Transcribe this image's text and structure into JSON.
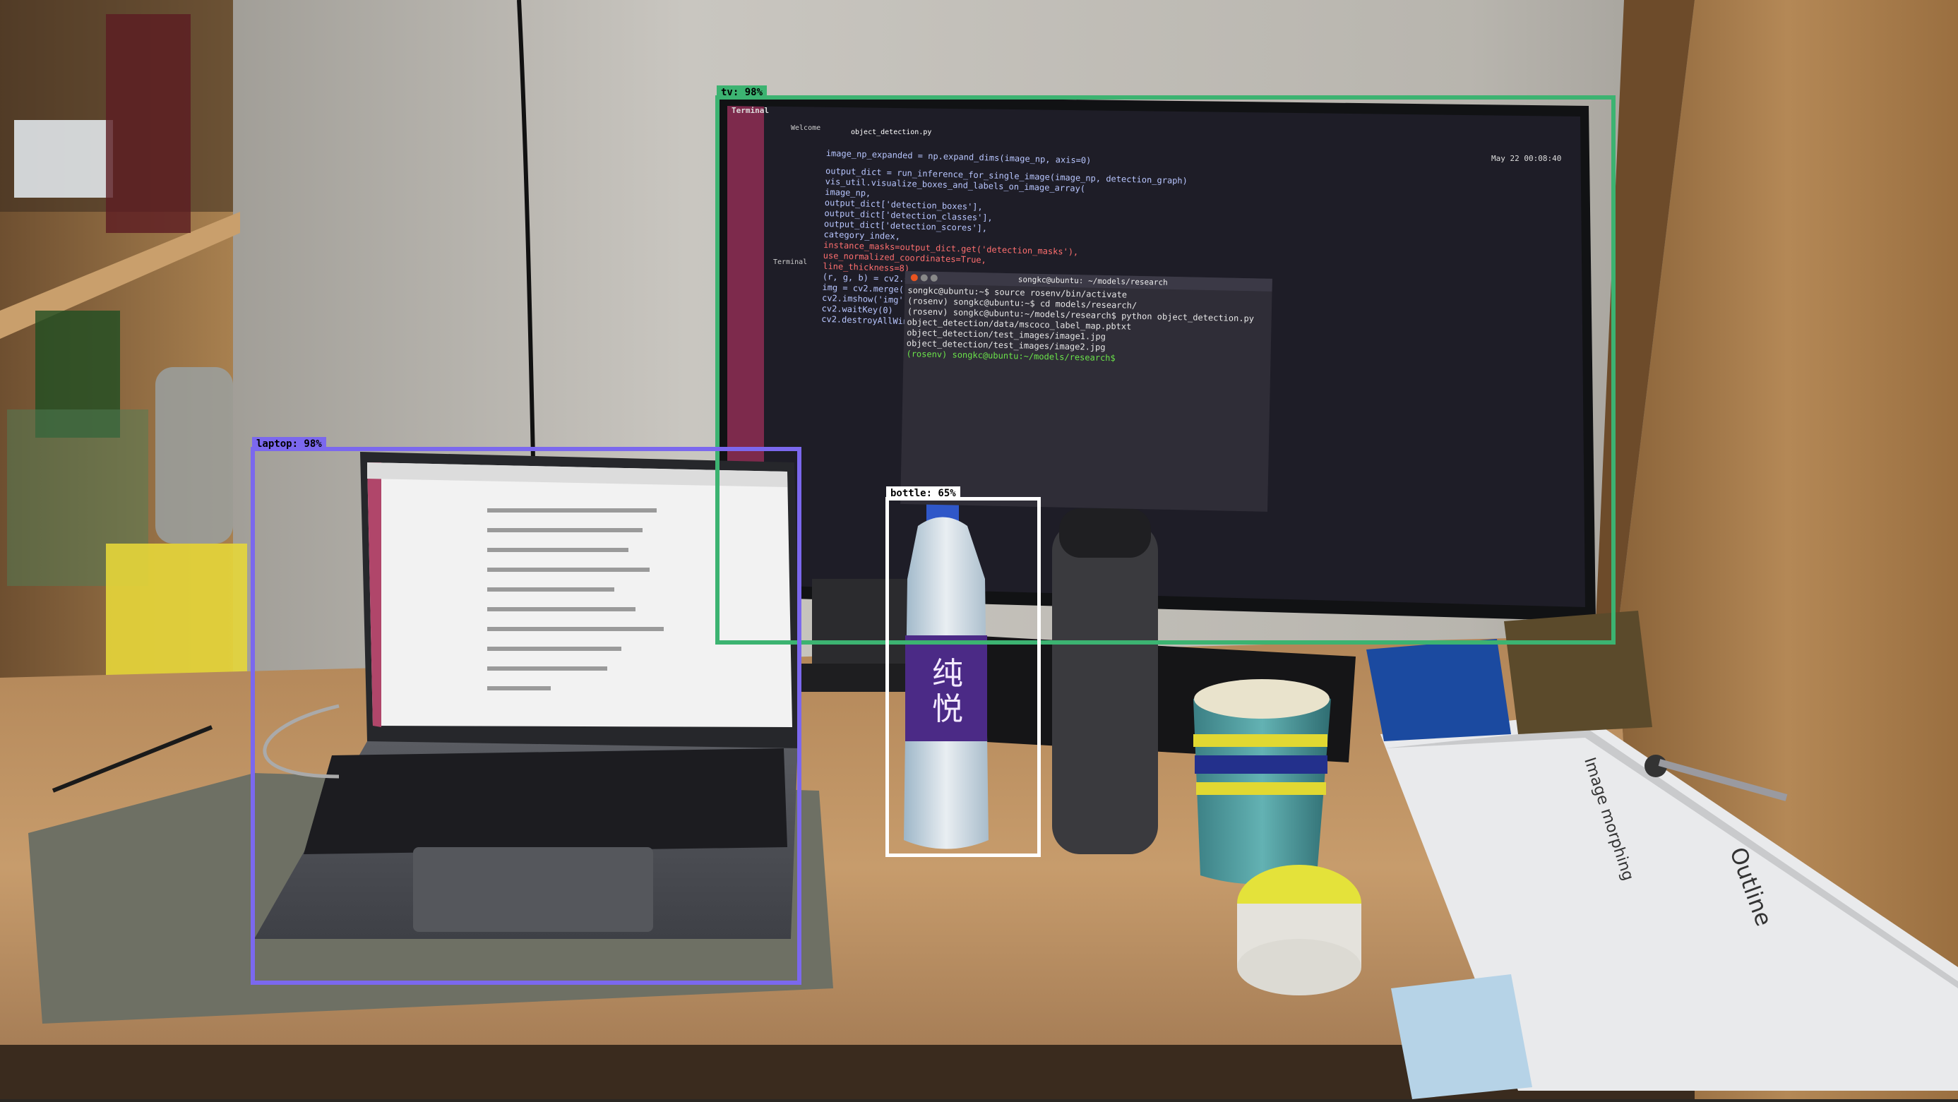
{
  "detections": [
    {
      "label": "tv",
      "score": "98%",
      "text": "tv: 98%",
      "color": "#3cb371"
    },
    {
      "label": "laptop",
      "score": "98%",
      "text": "laptop: 98%",
      "color": "#7b68ee"
    },
    {
      "label": "bottle",
      "score": "65%",
      "text": "bottle: 65%",
      "color": "#ffffff"
    }
  ],
  "monitor": {
    "app_title": "Terminal",
    "tab_welcome": "Welcome",
    "tab_file": "object_detection.py",
    "clock": "May 22 00:08:40",
    "panel_title": "Terminal",
    "code_lines": [
      "image_np_expanded = np.expand_dims(image_np, axis=0)",
      "output_dict = run_inference_for_single_image(image_np, detection_graph)",
      "vis_util.visualize_boxes_and_labels_on_image_array(",
      "    image_np,",
      "    output_dict['detection_boxes'],",
      "    output_dict['detection_classes'],",
      "    output_dict['detection_scores'],",
      "    category_index,",
      "    instance_masks=output_dict.get('detection_masks'),",
      "    use_normalized_coordinates=True,",
      "    line_thickness=8)",
      "(r, g, b) = cv2.split(image_np)",
      "img = cv2.merge([b, g, r])",
      "cv2.imshow('img', img)",
      "cv2.waitKey(0)",
      "cv2.destroyAllWindows()"
    ],
    "terminal_title": "songkc@ubuntu: ~/models/research",
    "terminal_lines": [
      "songkc@ubuntu:~$ source rosenv/bin/activate",
      "(rosenv) songkc@ubuntu:~$ cd models/research/",
      "(rosenv) songkc@ubuntu:~/models/research$ python object_detection.py",
      "object_detection/data/mscoco_label_map.pbtxt",
      "object_detection/test_images/image1.jpg",
      "object_detection/test_images/image2.jpg",
      "(rosenv) songkc@ubuntu:~/models/research$"
    ]
  },
  "bottle": {
    "brand": "纯悦"
  },
  "book": {
    "title": "Outline",
    "subtitle": "Image morphing"
  }
}
